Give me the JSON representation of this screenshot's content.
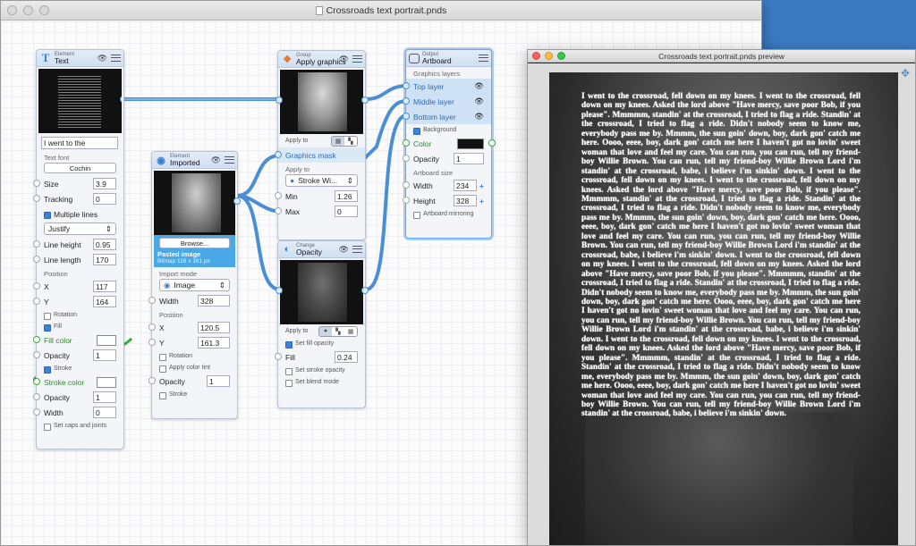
{
  "main_window": {
    "title": "Crossroads text portrait.pnds"
  },
  "nodes": {
    "text": {
      "type": "Element",
      "name": "Text",
      "text_value": "I went to the",
      "font_label": "Text font",
      "font_value": "Cochin",
      "size_label": "Size",
      "size_value": "3.9",
      "tracking_label": "Tracking",
      "tracking_value": "0",
      "multiple_lines": "Multiple lines",
      "justify": "Justify",
      "line_height_label": "Line height",
      "line_height_value": "0.95",
      "line_length_label": "Line length",
      "line_length_value": "170",
      "position_label": "Position",
      "x_label": "X",
      "x_value": "117",
      "y_label": "Y",
      "y_value": "164",
      "rotation": "Rotation",
      "fill": "Fill",
      "fill_color": "Fill color",
      "opacity_label": "Opacity",
      "opacity_value": "1",
      "stroke": "Stroke",
      "stroke_color": "Stroke color",
      "opacity2_label": "Opacity",
      "opacity2_value": "1",
      "width_label": "Width",
      "width_value": "0",
      "set_caps": "Set caps and joints"
    },
    "imported": {
      "type": "Element",
      "name": "Imported",
      "browse": "Browse...",
      "pasted_image": "Pasted image",
      "bitmap_info": "Bitmap 116 x 161 px",
      "import_mode_label": "Import mode",
      "import_mode_value": "Image",
      "width_label": "Width",
      "width_value": "328",
      "position_label": "Position",
      "x_label": "X",
      "x_value": "120.5",
      "y_label": "Y",
      "y_value": "161.3",
      "rotation": "Rotation",
      "apply_color_tint": "Apply color tint",
      "opacity_label": "Opacity",
      "opacity_value": "1",
      "stroke": "Stroke"
    },
    "group": {
      "type": "Group",
      "name": "Apply graphics",
      "apply_to": "Apply to",
      "graphics_mask": "Graphics mask",
      "apply_to2": "Apply to",
      "stroke_select": "Stroke Wi...",
      "min_label": "Min",
      "min_value": "1.26",
      "max_label": "Max",
      "max_value": "0"
    },
    "opacity": {
      "type": "Change",
      "name": "Opacity",
      "apply_to": "Apply to",
      "set_fill_opacity": "Set fill opacity",
      "fill_label": "Fill",
      "fill_value": "0.24",
      "set_stroke_opacity": "Set stroke opacity",
      "set_blend_mode": "Set blend mode"
    },
    "output": {
      "type": "Output",
      "name": "Artboard",
      "graphics_layers": "Graphics layers",
      "top_layer": "Top layer",
      "middle_layer": "Middle layer",
      "bottom_layer": "Bottom layer",
      "background": "Background",
      "color_label": "Color",
      "opacity_label": "Opacity",
      "opacity_value": "1",
      "artboard_size": "Artboard size",
      "width_label": "Width",
      "width_value": "234",
      "height_label": "Height",
      "height_value": "328",
      "artboard_mirroring": "Artboard mirroring"
    }
  },
  "preview": {
    "title": "Crossroads text portrait.pnds preview",
    "lyrics": "I went to the crossroad, fell down on my knees. I went to the crossroad, fell down on my knees. Asked the lord above \"Have mercy, save poor Bob, if you please\". Mmmmm, standin' at the crossroad, I tried to flag a ride. Standin' at the crossroad, I tried to flag a ride. Didn't nobody seem to know me, everybody pass me by. Mmmm, the sun goin' down, boy, dark gon' catch me here. Oooo, eeee, boy, dark gon' catch me here I haven't got no lovin' sweet woman that love and feel my care. You can run, you can run, tell my friend-boy Willie Brown. You can run, tell my friend-boy Willie Brown Lord i'm standin' at the crossroad, babe, i believe i'm sinkin' down. I went to the crossroad, fell down on my knees. I went to the crossroad, fell down on my knees. Asked the lord above \"Have mercy, save poor Bob, if you please\". Mmmmm, standin' at the crossroad, I tried to flag a ride. Standin' at the crossroad, I tried to flag a ride. Didn't nobody seem to know me, everybody pass me by. Mmmm, the sun goin' down, boy, dark gon' catch me here. Oooo, eeee, boy, dark gon' catch me here I haven't got no lovin' sweet woman that love and feel my care. You can run, you can run, tell my friend-boy Willie Brown. You can run, tell my friend-boy Willie Brown Lord i'm standin' at the crossroad, babe, i believe i'm sinkin' down. I went to the crossroad, fell down on my knees. I went to the crossroad, fell down on my knees. Asked the lord above \"Have mercy, save poor Bob, if you please\". Mmmmm, standin' at the crossroad, I tried to flag a ride. Standin' at the crossroad, I tried to flag a ride. Didn't nobody seem to know me, everybody pass me by. Mmmm, the sun goin' down, boy, dark gon' catch me here. Oooo, eeee, boy, dark gon' catch me here I haven't got no lovin' sweet woman that love and feel my care. You can run, you can run, tell my friend-boy Willie Brown. You can run, tell my friend-boy Willie Brown Lord i'm standin' at the crossroad, babe, i believe i'm sinkin' down. I went to the crossroad, fell down on my knees. I went to the crossroad, fell down on my knees. Asked the lord above \"Have mercy, save poor Bob, if you please\". Mmmmm, standin' at the crossroad, I tried to flag a ride. Standin' at the crossroad, I tried to flag a ride. Didn't nobody seem to know me, everybody pass me by. Mmmm, the sun goin' down, boy, dark gon' catch me here. Oooo, eeee, boy, dark gon' catch me here I haven't got no lovin' sweet woman that love and feel my care. You can run, you can run, tell my friend-boy Willie Brown. You can run, tell my friend-boy Willie Brown Lord i'm standin' at the crossroad, babe, i believe i'm sinkin' down."
  },
  "colors": {
    "desktop": "#3c7bc2",
    "link": "#4a8fd6",
    "stroke_link": "#3aaa3a",
    "accent": "#3b82d8"
  }
}
